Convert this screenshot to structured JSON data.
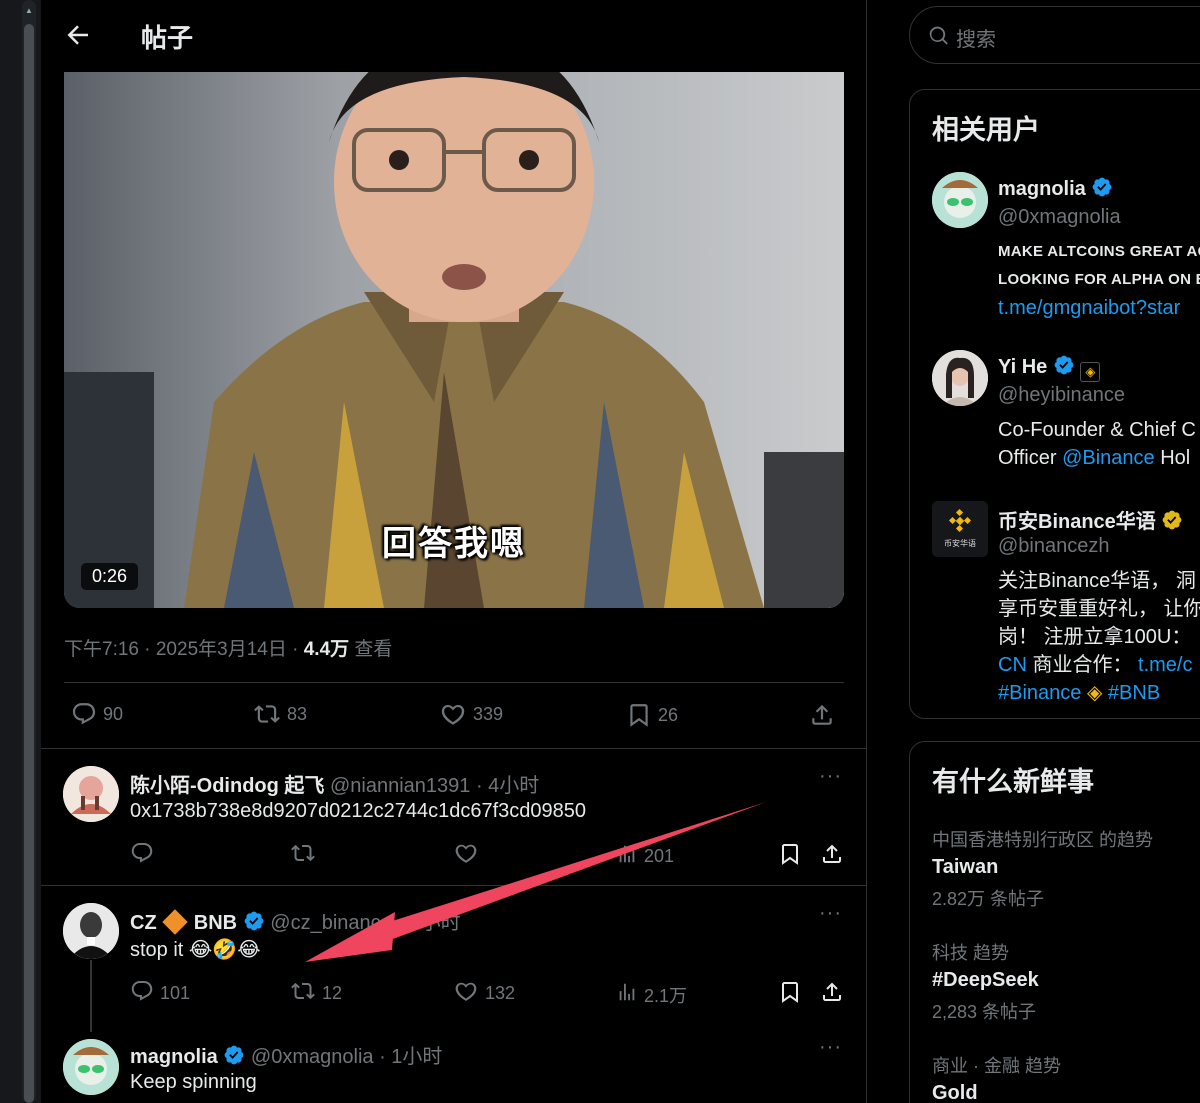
{
  "header": {
    "title": "帖子"
  },
  "video": {
    "caption": "回答我嗯",
    "time": "0:26"
  },
  "post_meta": {
    "time": "下午7:16 · 2025年3月14日 · ",
    "views": "4.4万",
    "views_label": " 查看"
  },
  "post_actions": {
    "replies": "90",
    "reposts": "83",
    "likes": "339",
    "bookmarks": "26"
  },
  "replies": [
    {
      "name": "陈小陌-Odindog 起飞",
      "handle": "@niannian1391 · 4小时",
      "text": "0x1738b738e8d9207d0212c2744c1dc67f3cd09850",
      "replies": "",
      "reposts": "",
      "likes": "",
      "views": "201"
    },
    {
      "name": "CZ",
      "name_suffix": "BNB",
      "handle": "@cz_binance · 4小时",
      "text": "stop it 😂🤣😂",
      "replies": "101",
      "reposts": "12",
      "likes": "132",
      "views": "2.1万"
    },
    {
      "name": "magnolia",
      "handle": "@0xmagnolia · 1小时",
      "text": "Keep spinning"
    }
  ],
  "search": {
    "placeholder": "搜索"
  },
  "related_users": {
    "title": "相关用户",
    "users": [
      {
        "name": "magnolia",
        "handle": "@0xmagnolia",
        "bio_line1": "MAKE ALTCOINS GREAT AG",
        "bio_line2": "LOOKING FOR ALPHA ON B",
        "bio_link": "t.me/gmgnaibot?star"
      },
      {
        "name": "Yi He",
        "handle": "@heyibinance",
        "bio_line1": "Co-Founder & Chief C",
        "bio_line2_pre": "Officer ",
        "bio_line2_link": "@Binance",
        "bio_line2_post": " Hol"
      },
      {
        "name": "币安Binance华语",
        "handle": "@binancezh",
        "bio_line1": "关注Binance华语， 洞",
        "bio_line2": "享币安重重好礼， 让你",
        "bio_line3": "岗！ 注册立拿100U：",
        "bio_line4_link": "CN",
        "bio_line4_text": " 商业合作：",
        "bio_line4_link2": "t.me/c",
        "bio_line5_tag1": "#Binance",
        "bio_line5_tag2": "#BNB",
        "avatar_label": "币安华语"
      }
    ]
  },
  "trends": {
    "title": "有什么新鲜事",
    "items": [
      {
        "context": "中国香港特别行政区 的趋势",
        "name": "Taiwan",
        "count": "2.82万 条帖子"
      },
      {
        "context": "科技 趋势",
        "name": "#DeepSeek",
        "count": "2,283 条帖子"
      },
      {
        "context": "商业 · 金融 趋势",
        "name": "Gold",
        "count": ""
      }
    ]
  },
  "colors": {
    "accent": "#1d9bf0",
    "annotation_arrow": "#f0455e",
    "background": "#000000"
  }
}
